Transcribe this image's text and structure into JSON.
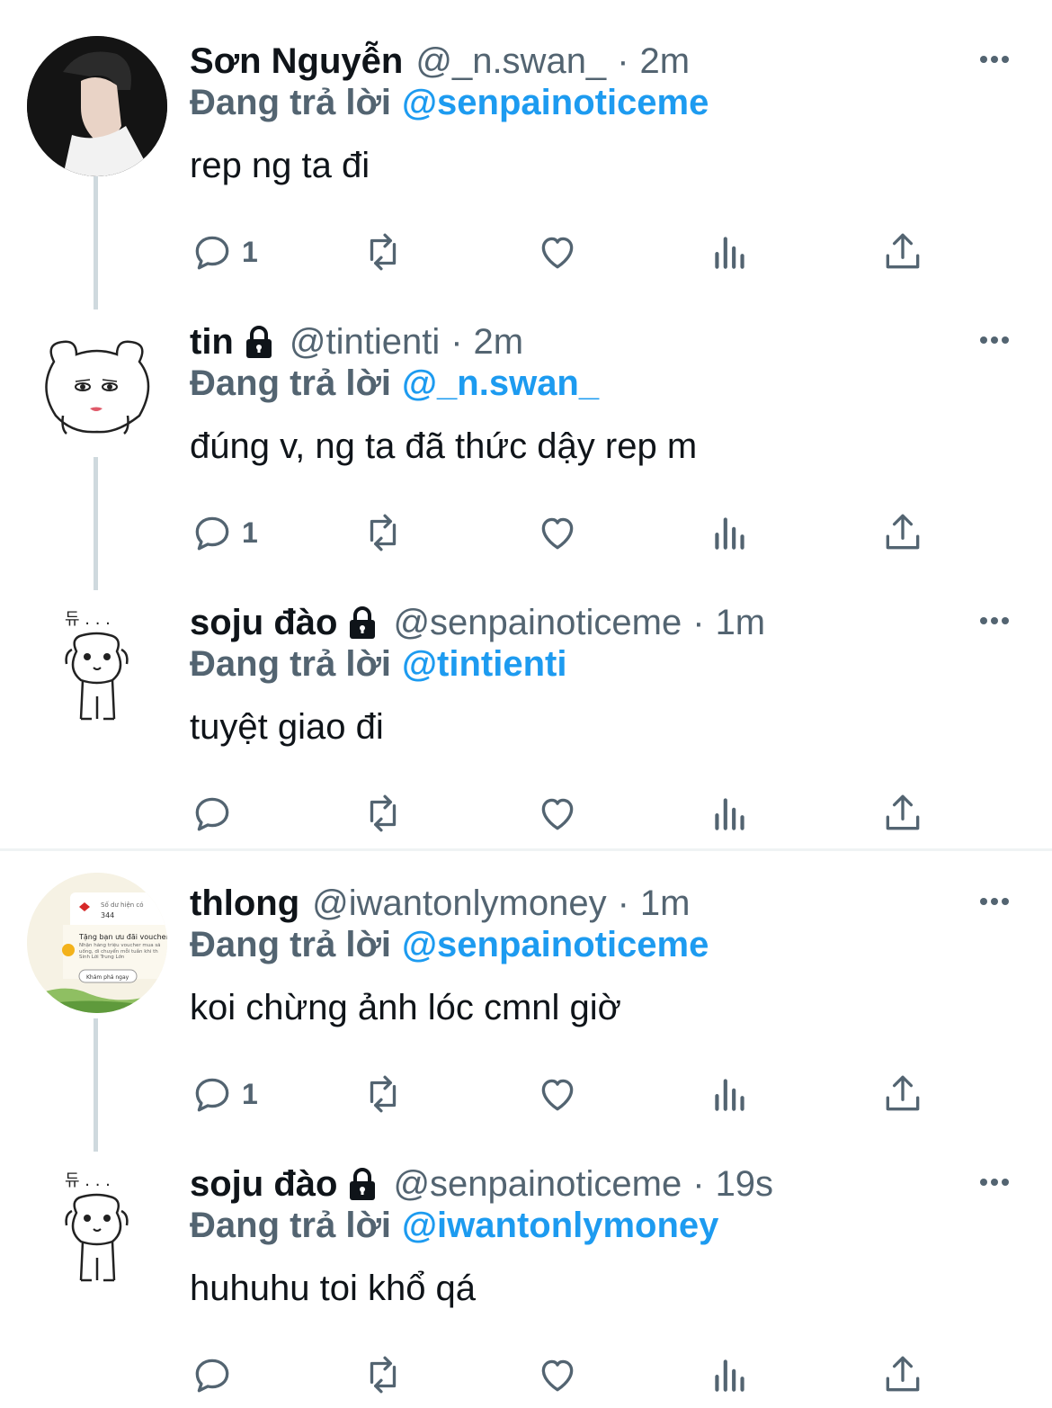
{
  "tweets": [
    {
      "name": "Sơn Nguyễn",
      "locked": false,
      "handle": "@_n.swan_",
      "dot": "·",
      "time": "2m",
      "replying_label": "Đang trả lời",
      "replying_to": "@senpainoticeme",
      "text": "rep ng ta đi",
      "reply_count": "1"
    },
    {
      "name": "tin",
      "locked": true,
      "handle": "@tintienti",
      "dot": "·",
      "time": "2m",
      "replying_label": "Đang trả lời",
      "replying_to": "@_n.swan_",
      "text": "đúng v, ng ta đã thức dậy rep m",
      "reply_count": "1"
    },
    {
      "name": "soju đào",
      "locked": true,
      "handle": "@senpainoticeme",
      "dot": "·",
      "time": "1m",
      "replying_label": "Đang trả lời",
      "replying_to": "@tintienti",
      "text": "tuyệt giao đi",
      "reply_count": ""
    },
    {
      "name": "thlong",
      "locked": false,
      "handle": "@iwantonlymoney",
      "dot": "·",
      "time": "1m",
      "replying_label": "Đang trả lời",
      "replying_to": "@senpainoticeme",
      "text": "koi chừng ảnh lóc cmnl giờ",
      "reply_count": "1"
    },
    {
      "name": "soju đào",
      "locked": true,
      "handle": "@senpainoticeme",
      "dot": "·",
      "time": "19s",
      "replying_label": "Đang trả lời",
      "replying_to": "@iwantonlymoney",
      "text": "huhuhu toi khổ qá",
      "reply_count": ""
    }
  ],
  "avatar_text": {
    "banner_balance_label": "Số dư hiện có",
    "banner_balance": "344",
    "banner_title": "Tặng bạn ưu đãi voucher",
    "banner_desc": "Nhận hàng triệu voucher mua sắ uống, di chuyển mỗi tuần khi th Sinh Lời Trung Lớn",
    "banner_button": "Khám phá ngay",
    "scribble": "듀 . . ."
  },
  "colors": {
    "text": "#0f1419",
    "secondary": "#536471",
    "accent": "#1d9bf0",
    "thread_line": "#cfd9de"
  },
  "icons": [
    "reply-icon",
    "retweet-icon",
    "like-icon",
    "views-icon",
    "share-icon",
    "more-icon",
    "lock-icon"
  ]
}
